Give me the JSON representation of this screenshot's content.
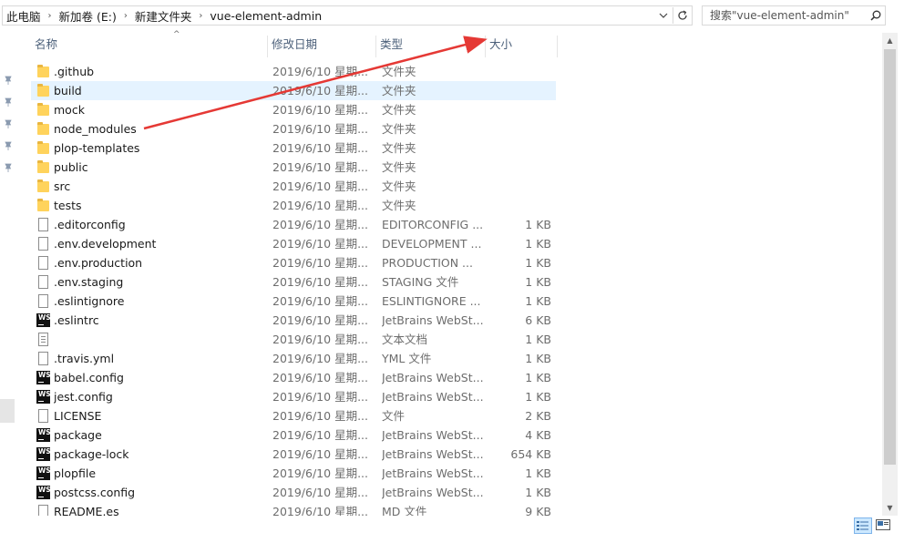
{
  "address_bar": {
    "crumbs": [
      "此电脑",
      "新加卷 (E:)",
      "新建文件夹",
      "vue-element-admin"
    ],
    "chevron_icon": "chevron-down-icon",
    "refresh_icon": "refresh-icon"
  },
  "search": {
    "placeholder": "搜索\"vue-element-admin\""
  },
  "columns": {
    "name": "名称",
    "date": "修改日期",
    "type": "类型",
    "size": "大小"
  },
  "files": [
    {
      "icon": "folder",
      "name": ".github",
      "date": "2019/6/10 星期...",
      "type": "文件夹",
      "size": ""
    },
    {
      "icon": "folder",
      "name": "build",
      "date": "2019/6/10 星期...",
      "type": "文件夹",
      "size": "",
      "selected": true
    },
    {
      "icon": "folder",
      "name": "mock",
      "date": "2019/6/10 星期...",
      "type": "文件夹",
      "size": ""
    },
    {
      "icon": "folder",
      "name": "node_modules",
      "date": "2019/6/10 星期...",
      "type": "文件夹",
      "size": ""
    },
    {
      "icon": "folder",
      "name": "plop-templates",
      "date": "2019/6/10 星期...",
      "type": "文件夹",
      "size": ""
    },
    {
      "icon": "folder",
      "name": "public",
      "date": "2019/6/10 星期...",
      "type": "文件夹",
      "size": ""
    },
    {
      "icon": "folder",
      "name": "src",
      "date": "2019/6/10 星期...",
      "type": "文件夹",
      "size": ""
    },
    {
      "icon": "folder",
      "name": "tests",
      "date": "2019/6/10 星期...",
      "type": "文件夹",
      "size": ""
    },
    {
      "icon": "file",
      "name": ".editorconfig",
      "date": "2019/6/10 星期...",
      "type": "EDITORCONFIG ...",
      "size": "1 KB"
    },
    {
      "icon": "file",
      "name": ".env.development",
      "date": "2019/6/10 星期...",
      "type": "DEVELOPMENT ...",
      "size": "1 KB"
    },
    {
      "icon": "file",
      "name": ".env.production",
      "date": "2019/6/10 星期...",
      "type": "PRODUCTION ...",
      "size": "1 KB"
    },
    {
      "icon": "file",
      "name": ".env.staging",
      "date": "2019/6/10 星期...",
      "type": "STAGING 文件",
      "size": "1 KB"
    },
    {
      "icon": "file",
      "name": ".eslintignore",
      "date": "2019/6/10 星期...",
      "type": "ESLINTIGNORE ...",
      "size": "1 KB"
    },
    {
      "icon": "ws",
      "name": ".eslintrc",
      "date": "2019/6/10 星期...",
      "type": "JetBrains WebSt...",
      "size": "6 KB"
    },
    {
      "icon": "txt",
      "name": "",
      "date": "2019/6/10 星期...",
      "type": "文本文档",
      "size": "1 KB"
    },
    {
      "icon": "file",
      "name": ".travis.yml",
      "date": "2019/6/10 星期...",
      "type": "YML 文件",
      "size": "1 KB"
    },
    {
      "icon": "ws",
      "name": "babel.config",
      "date": "2019/6/10 星期...",
      "type": "JetBrains WebSt...",
      "size": "1 KB"
    },
    {
      "icon": "ws",
      "name": "jest.config",
      "date": "2019/6/10 星期...",
      "type": "JetBrains WebSt...",
      "size": "1 KB"
    },
    {
      "icon": "file",
      "name": "LICENSE",
      "date": "2019/6/10 星期...",
      "type": "文件",
      "size": "2 KB"
    },
    {
      "icon": "ws",
      "name": "package",
      "date": "2019/6/10 星期...",
      "type": "JetBrains WebSt...",
      "size": "4 KB"
    },
    {
      "icon": "ws",
      "name": "package-lock",
      "date": "2019/6/10 星期...",
      "type": "JetBrains WebSt...",
      "size": "654 KB"
    },
    {
      "icon": "ws",
      "name": "plopfile",
      "date": "2019/6/10 星期...",
      "type": "JetBrains WebSt...",
      "size": "1 KB"
    },
    {
      "icon": "ws",
      "name": "postcss.config",
      "date": "2019/6/10 星期...",
      "type": "JetBrains WebSt...",
      "size": "1 KB"
    },
    {
      "icon": "file",
      "name": "README.es",
      "date": "2019/6/10 星期...",
      "type": "MD 文件",
      "size": "9 KB"
    }
  ],
  "ws_icon_text": "WS",
  "annotation": {
    "color": "#e53935"
  },
  "view_buttons": {
    "details": "details-view-icon",
    "tiles": "large-icons-view-icon"
  }
}
